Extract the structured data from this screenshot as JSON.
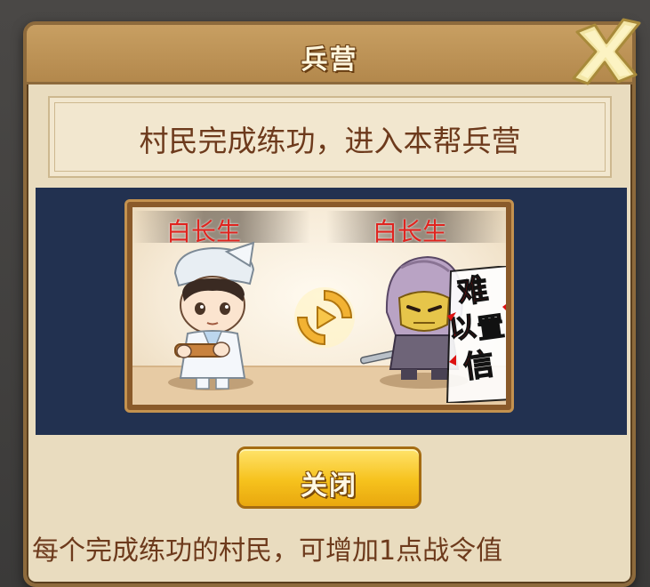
{
  "dialog": {
    "title": "兵营",
    "message": "村民完成练功，进入本帮兵营",
    "footer_note": "每个完成练功的村民，可增加1点战令值"
  },
  "scene": {
    "left_character": {
      "name": "白长生"
    },
    "right_character": {
      "name": "白长生"
    },
    "stamp": [
      "难",
      "以",
      "置",
      "信"
    ]
  },
  "buttons": {
    "close_label": "关闭"
  },
  "colors": {
    "title_bar": "#b3884c",
    "panel_bg": "#223150",
    "name_red": "#e0241f",
    "button_gold": "#f6c21d",
    "text_brown": "#6d3a1c"
  },
  "icons": {
    "close": "close-x-icon",
    "swap": "swap-arrow-icon"
  }
}
